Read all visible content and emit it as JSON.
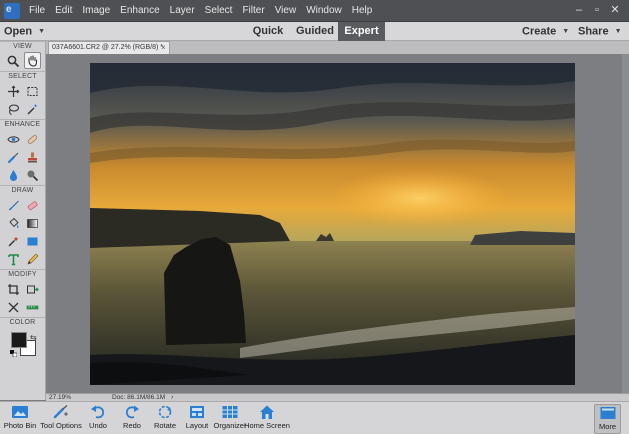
{
  "app": {
    "logo_letter": "e"
  },
  "menu": {
    "items": [
      "File",
      "Edit",
      "Image",
      "Enhance",
      "Layer",
      "Select",
      "Filter",
      "View",
      "Window",
      "Help"
    ]
  },
  "window_controls": {
    "minimize": "–",
    "maximize": "▫",
    "close": "✕"
  },
  "modebar": {
    "open_label": "Open",
    "tabs": [
      "Quick",
      "Guided",
      "Expert"
    ],
    "active_tab": "Expert",
    "create_label": "Create",
    "share_label": "Share"
  },
  "toolbox": {
    "sections": [
      "VIEW",
      "SELECT",
      "ENHANCE",
      "DRAW",
      "MODIFY",
      "COLOR"
    ],
    "active_tool": "hand-tool",
    "foreground_color": "#1a1a1a",
    "background_color": "#ffffff"
  },
  "document": {
    "tab_title": "037A6601.CR2 @ 27.2% (RGB/8) *",
    "close_symbol": "×"
  },
  "status": {
    "zoom": "27.19%",
    "doc_size": "Doc: 86.1M/86.1M",
    "arrow": "›"
  },
  "bottombar": {
    "buttons": [
      "Photo Bin",
      "Tool Options",
      "Undo",
      "Redo",
      "Rotate",
      "Layout",
      "Organizer",
      "Home Screen"
    ],
    "more_label": "More"
  },
  "colors": {
    "accent_blue": "#2b7fd3",
    "menubar": "#4f5054",
    "active_tab": "#5a5b5e"
  }
}
